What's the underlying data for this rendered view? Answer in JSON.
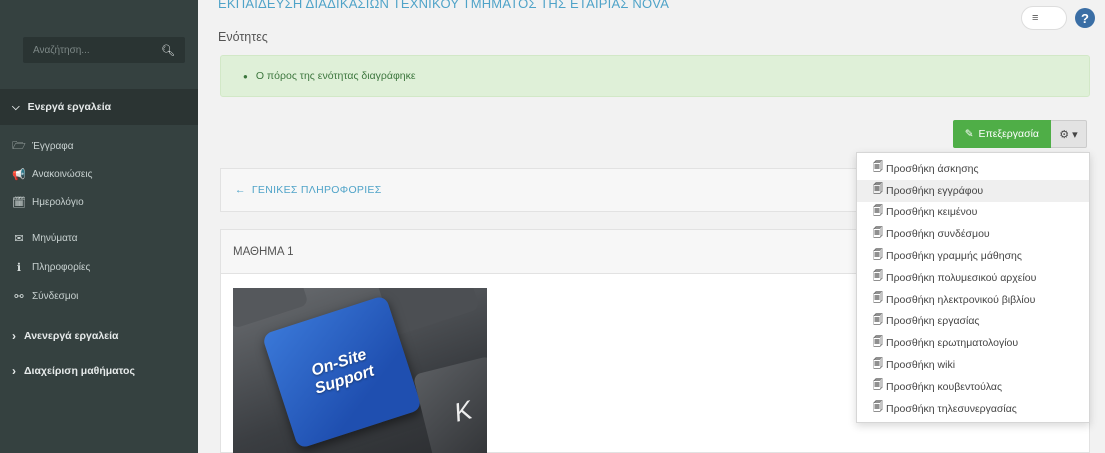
{
  "sidebar": {
    "search_placeholder": "Αναζήτηση...",
    "active_tools_label": "Ενεργά εργαλεία",
    "items": [
      {
        "icon": "folder-icon",
        "glyph": "🗁",
        "label": "Έγγραφα"
      },
      {
        "icon": "bullhorn-icon",
        "glyph": "📢",
        "label": "Ανακοινώσεις"
      },
      {
        "icon": "calendar-icon",
        "glyph": "🗓",
        "label": "Ημερολόγιο"
      },
      {
        "icon": "envelope-icon",
        "glyph": "✉",
        "label": "Μηνύματα"
      },
      {
        "icon": "info-icon",
        "glyph": "ℹ",
        "label": "Πληροφορίες"
      },
      {
        "icon": "link-icon",
        "glyph": "⚯",
        "label": "Σύνδεσμοι"
      }
    ],
    "inactive_tools_label": "Ανενεργά εργαλεία",
    "course_admin_label": "Διαχείριση μαθήματος"
  },
  "header": {
    "title": "ΕΚΠΑΙΔΕΥΣΗ ΔΙΑΔΙΚΑΣΙΩΝ ΤΕΧΝΙΚΟΥ ΤΜΗΜΑΤΟΣ ΤΗΣ ΕΤΑΙΡΙΑΣ NOVA",
    "subtitle": "Ενότητες"
  },
  "alert": {
    "message": "Ο πόρος της ενότητας διαγράφηκε"
  },
  "toolbar": {
    "edit_label": "Επεξεργασία",
    "gear_label": "⚙ ▾"
  },
  "sections": {
    "general_label": "ΓΕΝΙΚΕΣ ΠΛΗΡΟΦΟΡΙΕΣ",
    "lesson_title": "ΜΑΘΗΜΑ 1"
  },
  "thumbnail": {
    "key_text_line1": "On-Site",
    "key_text_line2": "Support",
    "key_letter": "K"
  },
  "dropdown": {
    "items": [
      "Προσθήκη άσκησης",
      "Προσθήκη εγγράφου",
      "Προσθήκη κειμένου",
      "Προσθήκη συνδέσμου",
      "Προσθήκη γραμμής μάθησης",
      "Προσθήκη πολυμεσικού αρχείου",
      "Προσθήκη ηλεκτρονικού βιβλίου",
      "Προσθήκη εργασίας",
      "Προσθήκη ερωτηματολογίου",
      "Προσθήκη wiki",
      "Προσθήκη κουβεντούλας",
      "Προσθήκη τηλεσυνεργασίας"
    ],
    "highlighted_index": 1
  },
  "colors": {
    "sidebar_bg": "#354140",
    "accent_blue": "#4fa3c8",
    "edit_green": "#4fae47",
    "alert_bg": "#dff0d8"
  }
}
